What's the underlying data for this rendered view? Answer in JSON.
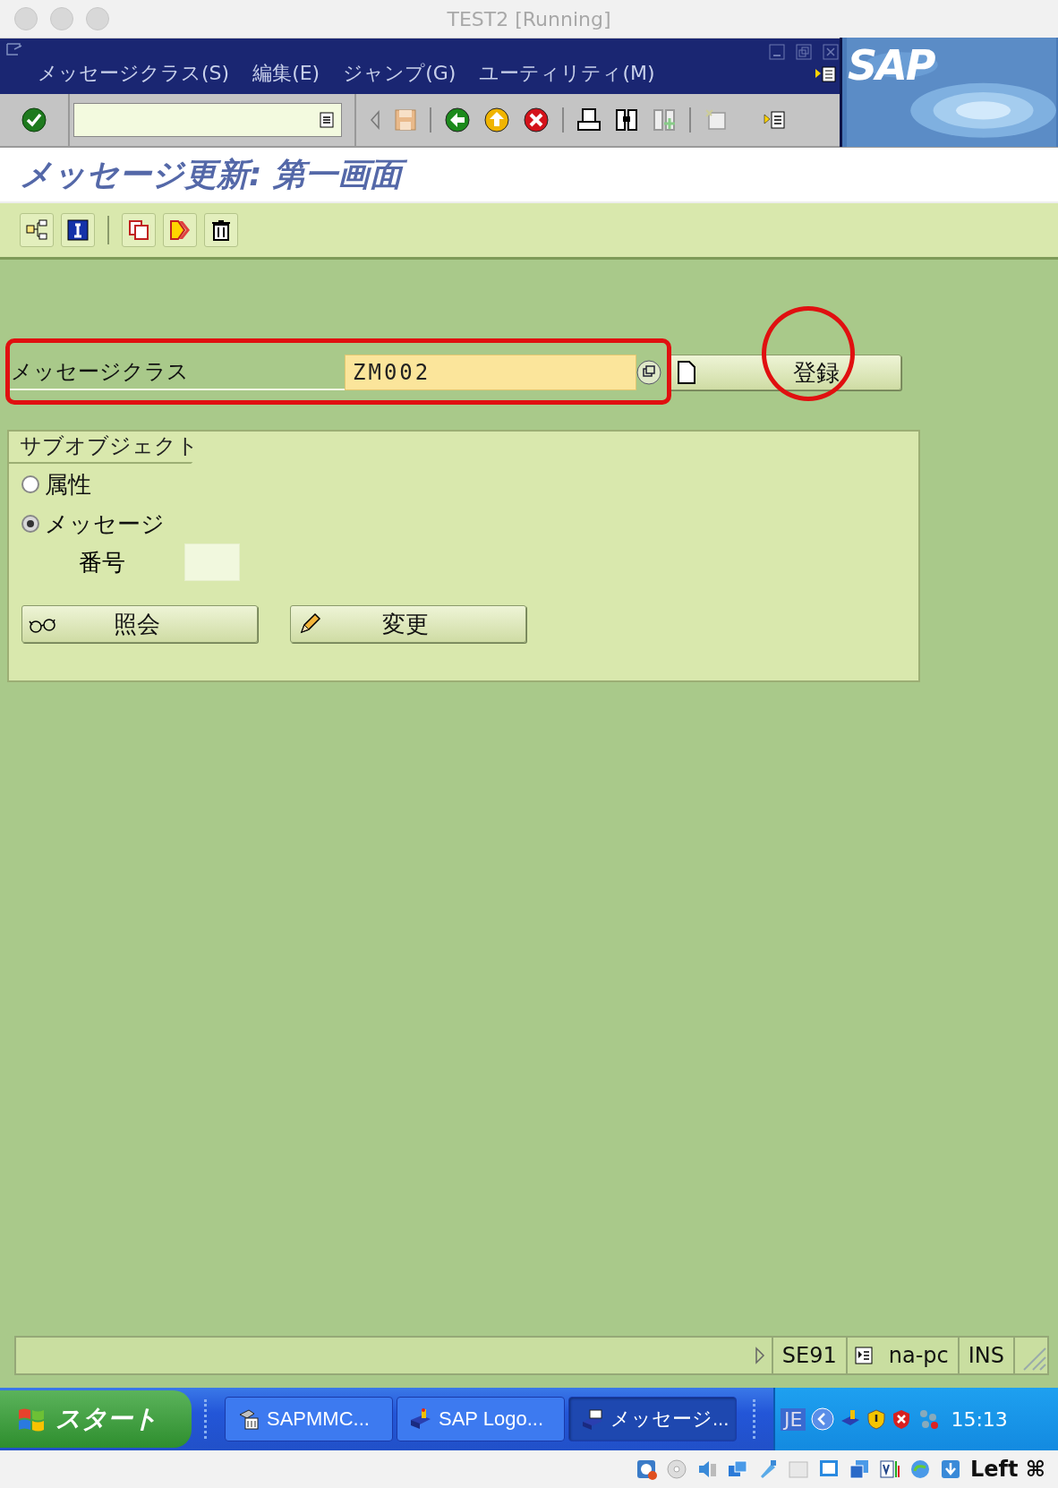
{
  "window": {
    "title": "TEST2 [Running]"
  },
  "menu": [
    {
      "label": "メッセージクラス(S)"
    },
    {
      "label": "編集(E)"
    },
    {
      "label": "ジャンプ(G)"
    },
    {
      "label": "ユーティリティ(M)"
    }
  ],
  "logo": "SAP",
  "screen_title": "メッセージ更新: 第一画面",
  "form": {
    "field_label": "メッセージクラス",
    "field_value": "ZM002",
    "create_button": "登録"
  },
  "subobject": {
    "title": "サブオブジェクト",
    "radios": [
      {
        "label": "属性",
        "selected": false
      },
      {
        "label": "メッセージ",
        "selected": true
      }
    ],
    "number_label": "番号",
    "buttons": [
      {
        "label": "照会",
        "kind": "display"
      },
      {
        "label": "変更",
        "kind": "change"
      }
    ]
  },
  "status_bar": {
    "transaction": "SE91",
    "server": "na-pc",
    "mode": "INS"
  },
  "taskbar": {
    "start": "スタート",
    "tasks": [
      {
        "label": "SAPMMC...",
        "selected": false
      },
      {
        "label": "SAP Logo...",
        "selected": false
      },
      {
        "label": "メッセージ...",
        "selected": true
      }
    ],
    "language": "JE",
    "time": "15:13"
  },
  "host_bar": {
    "key_label": "Left ⌘"
  }
}
